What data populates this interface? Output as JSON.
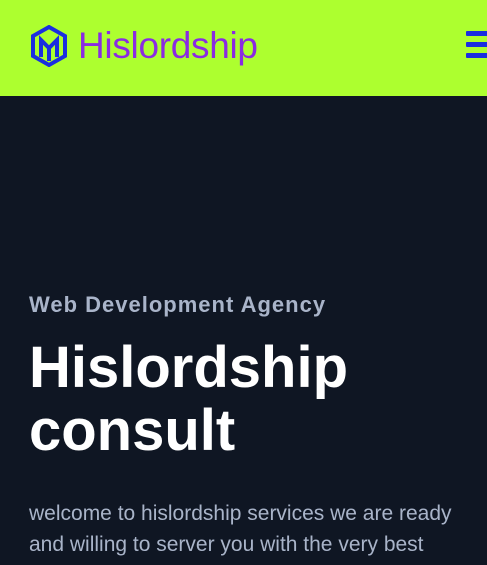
{
  "header": {
    "brand": "Hislordship",
    "logo_icon": "hexagon-m-logo",
    "menu_icon": "hamburger-menu-icon",
    "background_color": "#adff2f",
    "brand_color": "#8a2be2",
    "icon_color": "#1a2ee0"
  },
  "hero": {
    "eyebrow": "Web Development Agency",
    "title_line1": "Hislordship",
    "title_line2": "consult",
    "lead_line1": "welcome to hislordship services we are ready",
    "lead_line2": "and willing to server you with the very best",
    "background_color": "#0f1623"
  }
}
